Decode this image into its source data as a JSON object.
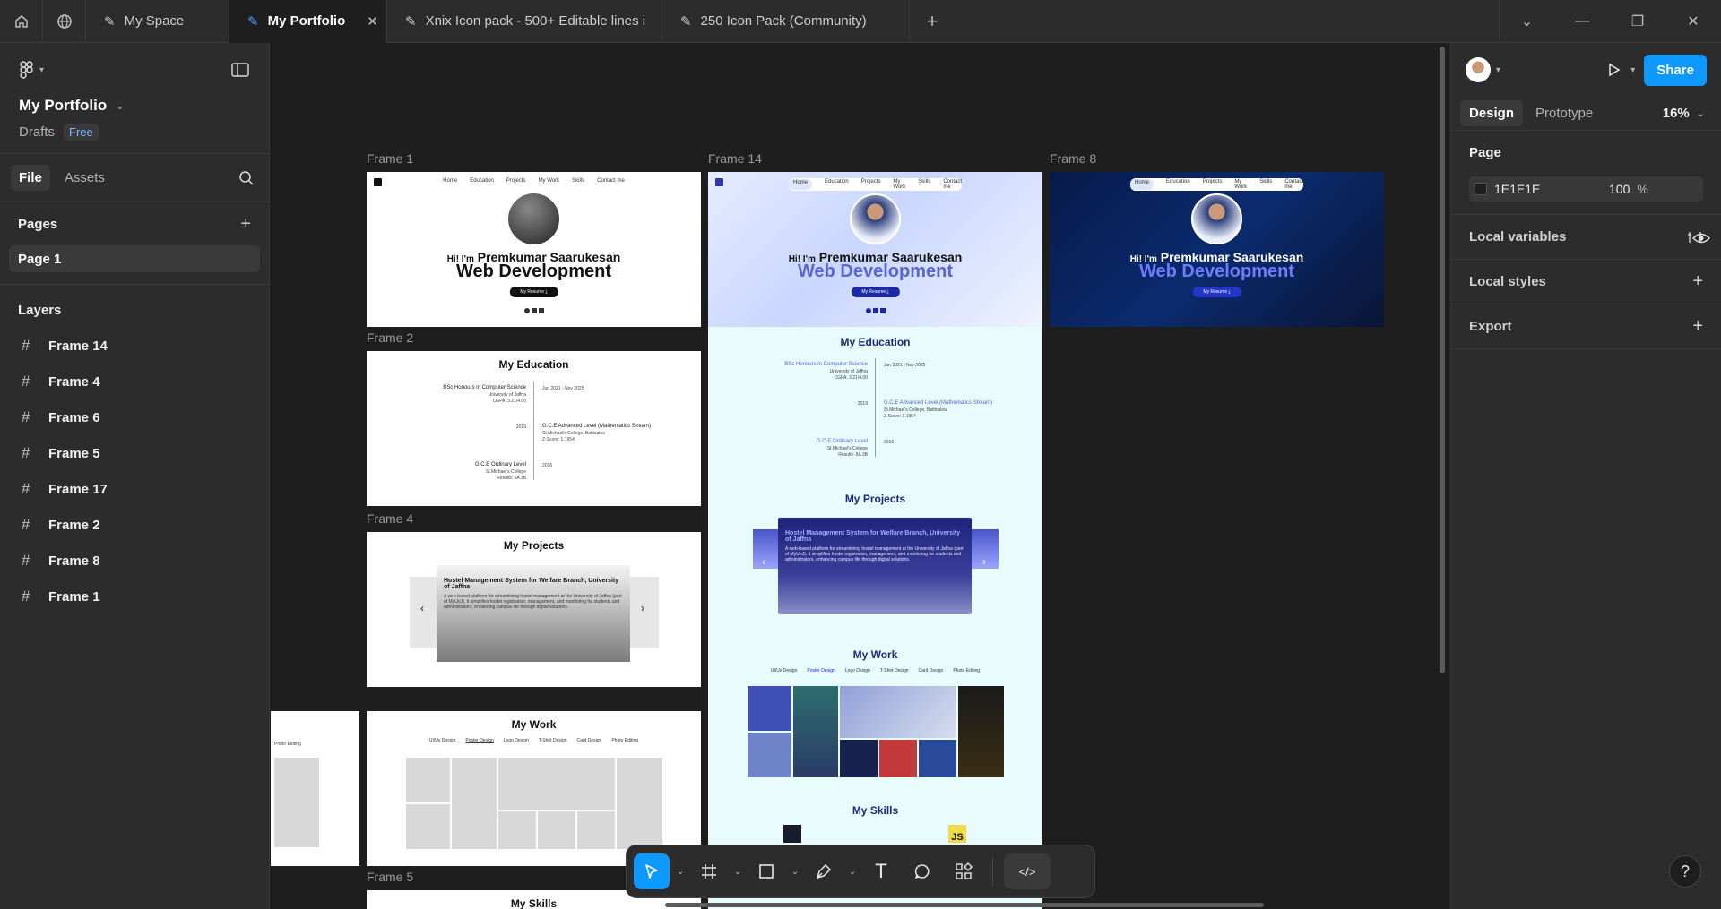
{
  "tabs": [
    {
      "label": "My Space",
      "active": false
    },
    {
      "label": "My Portfolio",
      "active": true
    },
    {
      "label": "Xnix Icon pack - 500+ Editable lines i",
      "active": false
    },
    {
      "label": "250 Icon Pack (Community)",
      "active": false
    }
  ],
  "file": {
    "name": "My Portfolio",
    "location": "Drafts",
    "plan": "Free"
  },
  "left_tabs": {
    "file": "File",
    "assets": "Assets"
  },
  "pages": {
    "title": "Pages",
    "items": [
      "Page 1"
    ]
  },
  "layers": {
    "title": "Layers",
    "items": [
      "Frame 14",
      "Frame 4",
      "Frame 6",
      "Frame 5",
      "Frame 17",
      "Frame 2",
      "Frame 8",
      "Frame 1"
    ]
  },
  "right": {
    "tabs": {
      "design": "Design",
      "prototype": "Prototype"
    },
    "zoom": "16%",
    "share": "Share",
    "page_title": "Page",
    "bg_hex": "1E1E1E",
    "bg_opacity": "100",
    "bg_percent": "%",
    "local_variables": "Local variables",
    "local_styles": "Local styles",
    "export": "Export"
  },
  "frames": {
    "frame1": "Frame 1",
    "frame14": "Frame 14",
    "frame8": "Frame 8",
    "frame2": "Frame 2",
    "frame4": "Frame 4",
    "frame5": "Frame 5"
  },
  "site": {
    "nav": [
      "Home",
      "Education",
      "Projects",
      "My Work",
      "Skills",
      "Contact me"
    ],
    "hello": "Hi! I'm",
    "name": "Premkumar Saarukesan",
    "role": "Web Development",
    "resume": "My Resume ⤓",
    "education_title": "My Education",
    "edu": [
      {
        "title": "BSc Honours in Computer Science",
        "sub": "University of Jaffna",
        "extra": "CGPA: 3.21/4.00",
        "date": "Jun 2021 - Nov 2025"
      },
      {
        "title": "G.C.E Advanced Level (Mathematics Stream)",
        "sub": "St.Michael's College, Batticaloa",
        "extra": "Z-Score: 1.1954",
        "date": "2019"
      },
      {
        "title": "G.C.E Ordinary Level",
        "sub": "St.Michael's College",
        "extra": "Results: 6A 3B",
        "date": "2016"
      }
    ],
    "projects_title": "My Projects",
    "project_title": "Hostel Management System for Welfare Branch, University of Jaffna",
    "project_desc": "A web-based platform for streamlining hostel management at the University of Jaffna (part of MyUoJ). It simplifies hostel registration, management, and monitoring for students and administrators, enhancing campus life through digital solutions.",
    "work_title": "My Work",
    "work_tabs": [
      "UI/Ux Design",
      "Poster Design",
      "Logo Design",
      "T-Shirt Design",
      "Card Design",
      "Photo Editing"
    ],
    "skills_title": "My Skills",
    "photo_editing": "Photo Editing",
    "js": "JS"
  }
}
